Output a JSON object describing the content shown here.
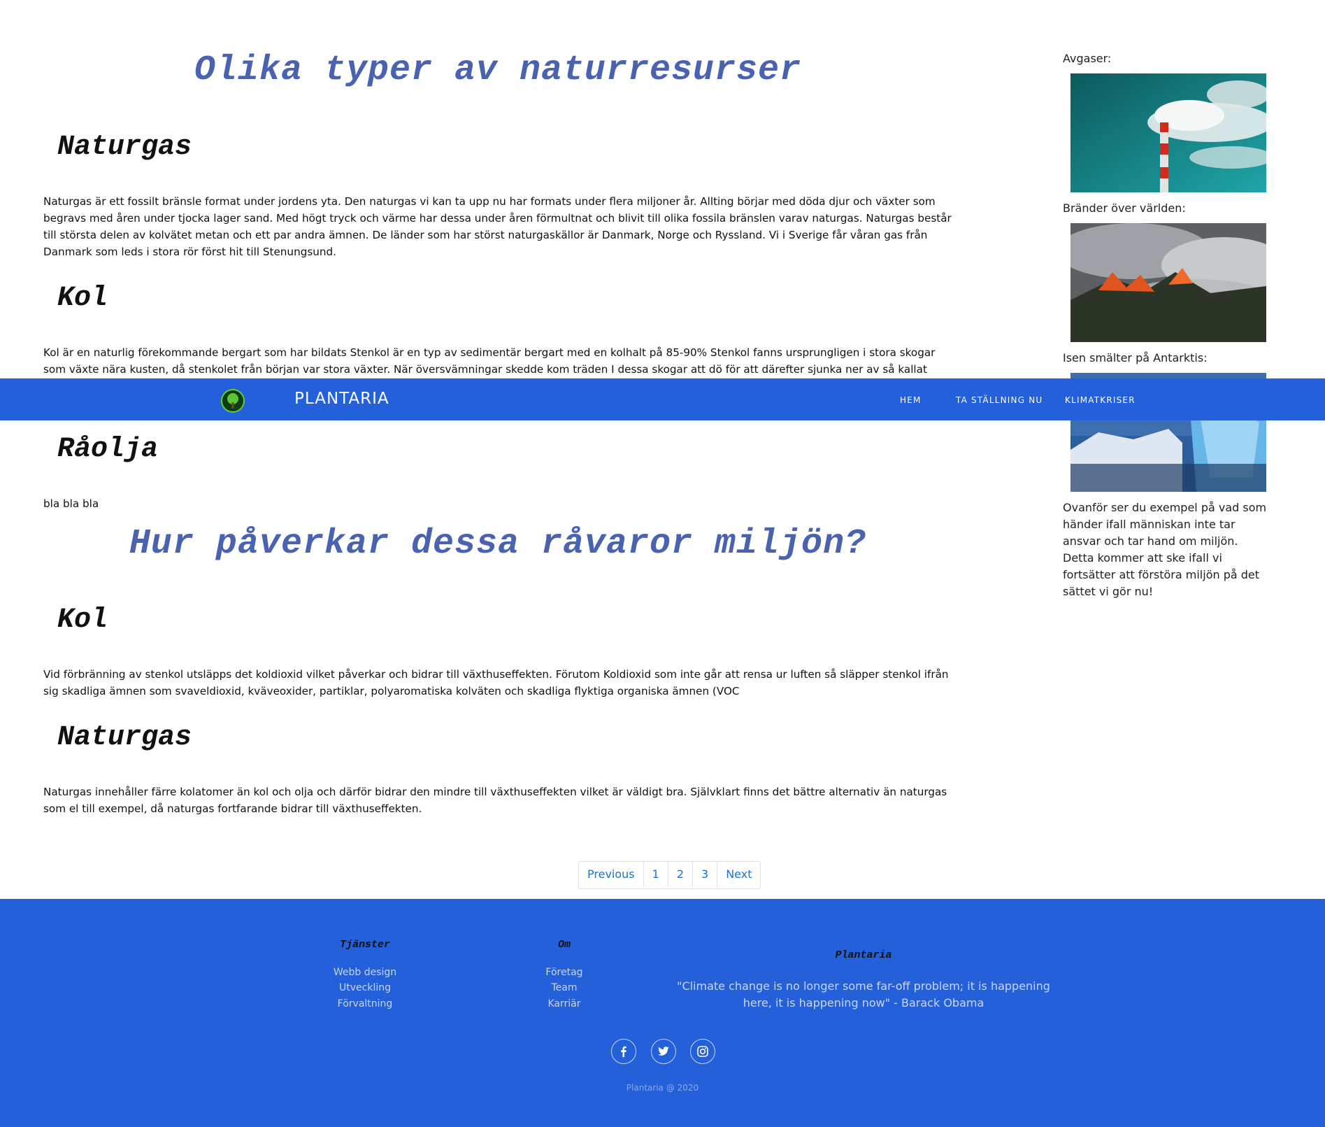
{
  "main": {
    "title1": "Olika typer av naturresurser",
    "sections1": [
      {
        "heading": "Naturgas",
        "text": "Naturgas är ett fossilt bränsle format under jordens yta. Den naturgas vi kan ta upp nu har formats under flera miljoner år. Allting börjar med döda djur och växter som begravs med åren under tjocka lager sand. Med högt tryck och värme har dessa under åren förmultnat och blivit till olika fossila bränslen varav naturgas. Naturgas består till största delen av kolvätet metan och ett par andra ämnen. De länder som har störst naturgaskällor är Danmark, Norge och Ryssland. Vi i Sverige får våran gas från Danmark som leds i stora rör först hit till Stenungsund."
      },
      {
        "heading": "Kol",
        "text": "Kol är en naturlig förekommande bergart som har bildats Stenkol är en typ av sedimentär bergart med en kolhalt på 85-90% Stenkol fanns ursprungligen i stora skogar som växte nära kusten, då stenkolet från början var stora växter. När översvämningar skedde kom träden I dessa skogar att dö för att därefter sjunka ner av så kallat sediment. Sediment är då material"
      },
      {
        "heading": "Råolja",
        "text": "bla bla bla"
      }
    ],
    "title2": "Hur påverkar dessa råvaror miljön?",
    "sections2": [
      {
        "heading": "Kol",
        "text": "Vid förbränning av stenkol utsläpps det koldioxid vilket påverkar och bidrar till växthuseffekten. Förutom Koldioxid som inte går att rensa ur luften så släpper stenkol ifrån sig skadliga ämnen som svaveldioxid, kväveoxider, partiklar, polyaromatiska kolväten och skadliga flyktiga organiska ämnen (VOC"
      },
      {
        "heading": "Naturgas",
        "text": "Naturgas innehåller färre kolatomer än kol och olja och därför bidrar den mindre till växthuseffekten vilket är väldigt bra. Självklart finns det bättre alternativ än naturgas som el till exempel, då naturgas fortfarande bidrar till växthuseffekten."
      }
    ]
  },
  "sidebar": {
    "label1": "Avgaser:",
    "label2": "Bränder över världen:",
    "label3": "Isen smälter på Antarktis:",
    "text": "Ovanför ser du exempel på vad som händer ifall människan inte tar ansvar och tar hand om miljön. Detta kommer att ske ifall vi fortsätter att förstöra miljön på det sättet vi gör nu!"
  },
  "navbar": {
    "brand": "PLANTARIA",
    "items": [
      "HEM",
      "TA STÄLLNING NU",
      "KLIMATKRISER"
    ]
  },
  "pagination": {
    "previous": "Previous",
    "pages": [
      "1",
      "2",
      "3"
    ],
    "next": "Next"
  },
  "footer": {
    "col1": {
      "heading": "Tjänster",
      "links": [
        "Webb design",
        "Utveckling",
        "Förvaltning"
      ]
    },
    "col2": {
      "heading": "Om",
      "links": [
        "Företag",
        "Team",
        "Karriär"
      ]
    },
    "col3": {
      "heading": "Plantaria",
      "quote": "\"Climate change is no longer some far-off problem; it is happening here, it is happening now\" - Barack Obama"
    },
    "social": [
      "facebook-icon",
      "twitter-icon",
      "instagram-icon"
    ],
    "copyright": "Plantaria @ 2020"
  },
  "colors": {
    "brand_blue": "#2360da",
    "title_blue": "#4a63b0",
    "link_blue": "#1a73d9"
  }
}
